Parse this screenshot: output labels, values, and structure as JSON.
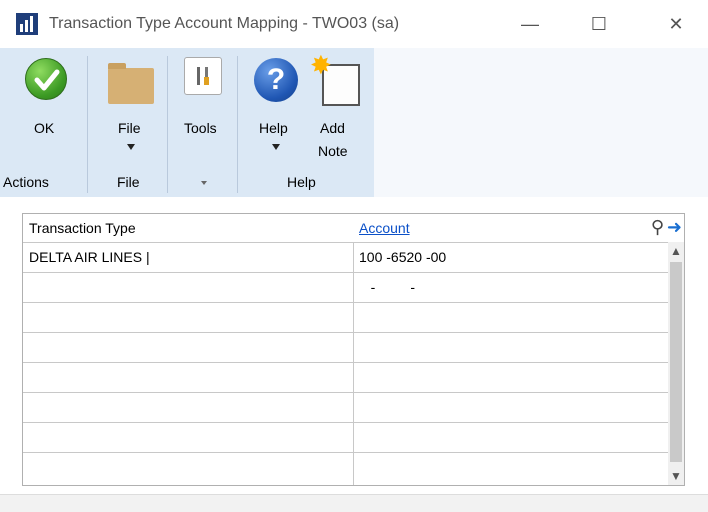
{
  "window": {
    "title": "Transaction Type Account Mapping  -  TWO03 (sa)",
    "minimize_glyph": "—",
    "maximize_glyph": "☐",
    "close_glyph": "✕"
  },
  "ribbon": {
    "ok_label": "OK",
    "file_label": "File",
    "tools_label": "Tools",
    "help_label": "Help",
    "add_note_label_1": "Add",
    "add_note_label_2": "Note",
    "help_glyph": "?",
    "groups": {
      "actions": "Actions",
      "file": "File",
      "help": "Help"
    }
  },
  "grid": {
    "columns": [
      "Transaction Type",
      "Account"
    ],
    "rows": [
      [
        "DELTA AIR LINES |",
        "100 -6520 -00"
      ],
      [
        "",
        "   -         -"
      ],
      [
        "",
        ""
      ],
      [
        "",
        ""
      ],
      [
        "",
        ""
      ],
      [
        "",
        ""
      ],
      [
        "",
        ""
      ],
      [
        "",
        ""
      ]
    ]
  },
  "icons": {
    "ok": "ok-check-icon",
    "file": "folder-icon",
    "tools": "tools-icon",
    "help": "help-question-icon",
    "note": "add-note-icon",
    "zoom": "lookup-magnifier-icon",
    "go": "go-arrow-icon"
  }
}
